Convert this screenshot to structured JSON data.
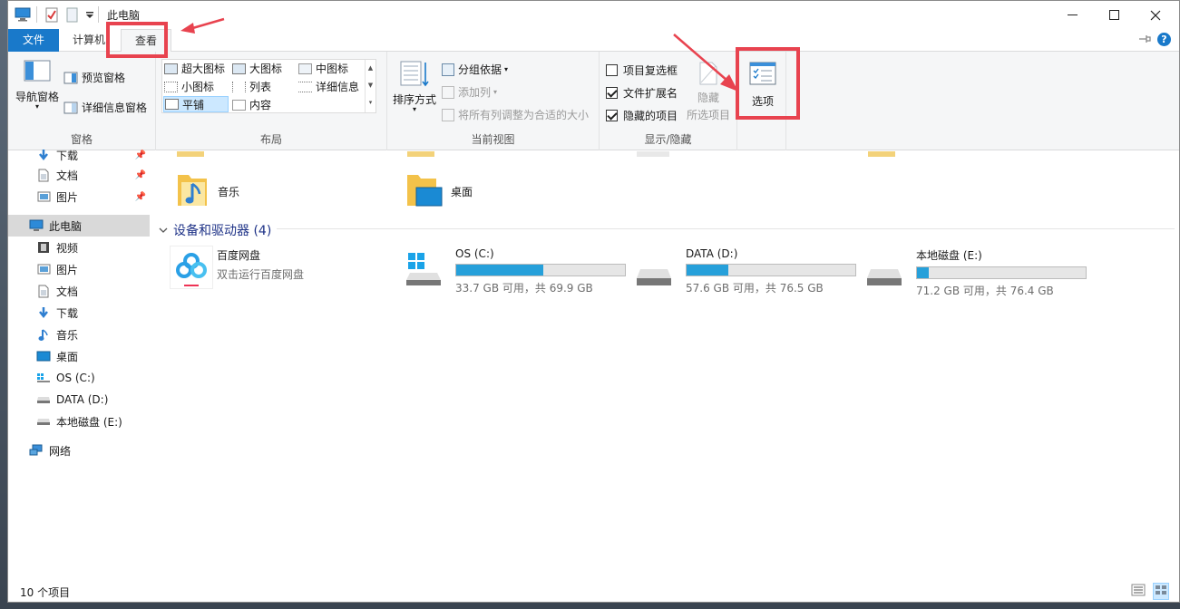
{
  "window": {
    "title": "此电脑",
    "minimize_icon": "minimize-icon",
    "maximize_icon": "maximize-icon",
    "close_icon": "close-icon"
  },
  "tabs": {
    "file": "文件",
    "computer": "计算机",
    "view": "查看"
  },
  "ribbon": {
    "panes": {
      "label": "窗格",
      "nav_pane": "导航窗格",
      "preview_pane": "预览窗格",
      "details_pane": "详细信息窗格"
    },
    "layout": {
      "label": "布局",
      "items": [
        "超大图标",
        "大图标",
        "中图标",
        "小图标",
        "列表",
        "详细信息",
        "平铺",
        "内容"
      ]
    },
    "current_view": {
      "label": "当前视图",
      "sort_by": "排序方式",
      "group_by": "分组依据",
      "add_column": "添加列",
      "size_columns": "将所有列调整为合适的大小"
    },
    "show_hide": {
      "label": "显示/隐藏",
      "item_checkboxes": "项目复选框",
      "file_extensions": "文件扩展名",
      "hidden_items": "隐藏的项目",
      "hide_selected_1": "隐藏",
      "hide_selected_2": "所选项目",
      "item_checkboxes_checked": false,
      "file_extensions_checked": true,
      "hidden_items_checked": true
    },
    "options": "选项"
  },
  "sidebar": {
    "quick": [
      {
        "label": "下载",
        "icon": "download-icon"
      },
      {
        "label": "文档",
        "icon": "document-icon"
      },
      {
        "label": "图片",
        "icon": "picture-icon"
      }
    ],
    "this_pc": "此电脑",
    "pc_items": [
      {
        "label": "视频",
        "icon": "video-icon"
      },
      {
        "label": "图片",
        "icon": "picture-icon"
      },
      {
        "label": "文档",
        "icon": "document-icon"
      },
      {
        "label": "下载",
        "icon": "download-icon"
      },
      {
        "label": "音乐",
        "icon": "music-icon"
      },
      {
        "label": "桌面",
        "icon": "desktop-icon"
      },
      {
        "label": "OS (C:)",
        "icon": "windows-drive-icon"
      },
      {
        "label": "DATA (D:)",
        "icon": "drive-icon"
      },
      {
        "label": "本地磁盘 (E:)",
        "icon": "drive-icon"
      }
    ],
    "network": "网络"
  },
  "content": {
    "folders": [
      {
        "label": "音乐",
        "icon": "music-folder-icon"
      },
      {
        "label": "桌面",
        "icon": "desktop-folder-icon"
      }
    ],
    "devices_header": "设备和驱动器 (4)",
    "app": {
      "name": "百度网盘",
      "sub": "双击运行百度网盘"
    },
    "drives": [
      {
        "name": "OS (C:)",
        "sub": "33.7 GB 可用，共 69.9 GB",
        "used_fraction": 0.518
      },
      {
        "name": "DATA (D:)",
        "sub": "57.6 GB 可用，共 76.5 GB",
        "used_fraction": 0.247
      },
      {
        "name": "本地磁盘 (E:)",
        "sub": "71.2 GB 可用，共 76.4 GB",
        "used_fraction": 0.068
      }
    ]
  },
  "status": {
    "count": "10 个项目"
  },
  "colors": {
    "accent": "#1979ca",
    "annotation": "#e8434f",
    "drive_bar": "#26a0da"
  }
}
